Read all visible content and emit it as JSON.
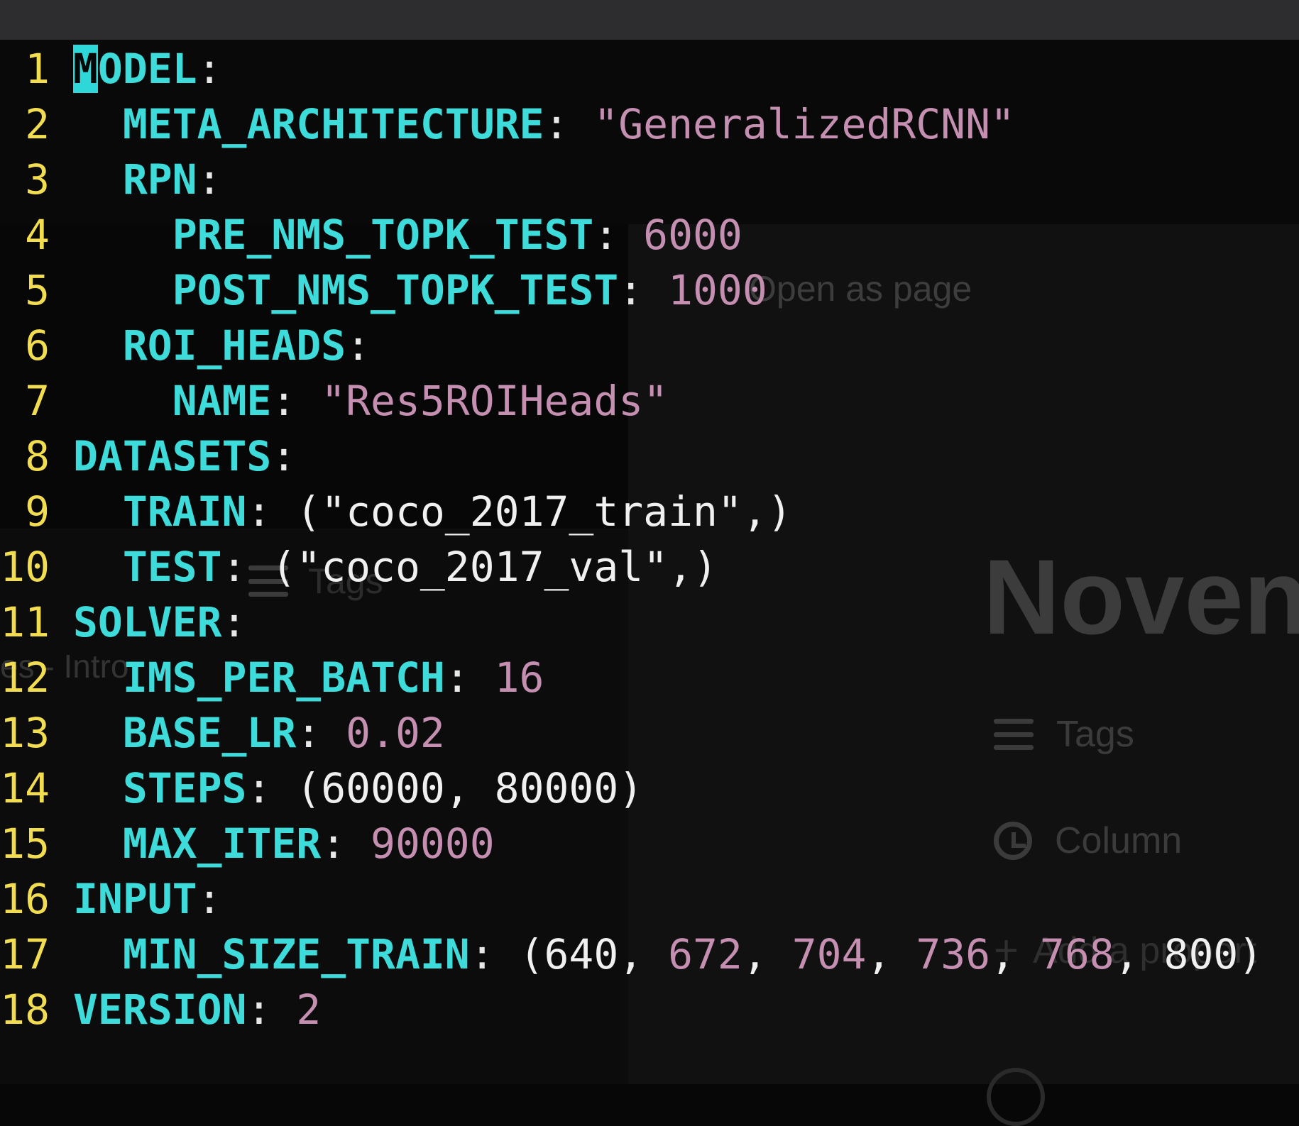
{
  "background": {
    "open_as_page": "Open as page",
    "title_fragment": "Noven",
    "intro_fragment": "es - Intro",
    "tags_label": "Tags",
    "column_label": "Column",
    "add_property": "Add a propert"
  },
  "colors": {
    "line_number": "#f2dc50",
    "key": "#3ddbd9",
    "string": "#c48fb0",
    "plain": "#f0f0f0",
    "cursor": "#2fd8d8"
  },
  "code_lines": [
    {
      "n": "1",
      "indent": "",
      "key": "MODEL",
      "rest": ":"
    },
    {
      "n": "2",
      "indent": "  ",
      "key": "META_ARCHITECTURE",
      "rest": ": ",
      "str": "\"GeneralizedRCNN\""
    },
    {
      "n": "3",
      "indent": "  ",
      "key": "RPN",
      "rest": ":"
    },
    {
      "n": "4",
      "indent": "    ",
      "key": "PRE_NMS_TOPK_TEST",
      "rest": ": ",
      "num": "6000"
    },
    {
      "n": "5",
      "indent": "    ",
      "key": "POST_NMS_TOPK_TEST",
      "rest": ": ",
      "num": "1000"
    },
    {
      "n": "6",
      "indent": "  ",
      "key": "ROI_HEADS",
      "rest": ":"
    },
    {
      "n": "7",
      "indent": "    ",
      "key": "NAME",
      "rest": ": ",
      "str": "\"Res5ROIHeads\""
    },
    {
      "n": "8",
      "indent": "",
      "key": "DATASETS",
      "rest": ":"
    },
    {
      "n": "9",
      "indent": "  ",
      "key": "TRAIN",
      "rest": ": ",
      "plain": "(\"coco_2017_train\",)"
    },
    {
      "n": "10",
      "indent": "  ",
      "key": "TEST",
      "rest": ": ",
      "plain": "(\"coco_2017_val\",)"
    },
    {
      "n": "11",
      "indent": "",
      "key": "SOLVER",
      "rest": ":"
    },
    {
      "n": "12",
      "indent": "  ",
      "key": "IMS_PER_BATCH",
      "rest": ": ",
      "num": "16"
    },
    {
      "n": "13",
      "indent": "  ",
      "key": "BASE_LR",
      "rest": ": ",
      "num": "0.02"
    },
    {
      "n": "14",
      "indent": "  ",
      "key": "STEPS",
      "rest": ": ",
      "plain": "(60000, 80000)"
    },
    {
      "n": "15",
      "indent": "  ",
      "key": "MAX_ITER",
      "rest": ": ",
      "num": "90000"
    },
    {
      "n": "16",
      "indent": "",
      "key": "INPUT",
      "rest": ":"
    },
    {
      "n": "17",
      "indent": "  ",
      "key": "MIN_SIZE_TRAIN",
      "rest": ": ",
      "tuple": [
        "640",
        "672",
        "704",
        "736",
        "768",
        "800"
      ]
    },
    {
      "n": "18",
      "indent": "",
      "key": "VERSION",
      "rest": ": ",
      "num": "2"
    }
  ]
}
